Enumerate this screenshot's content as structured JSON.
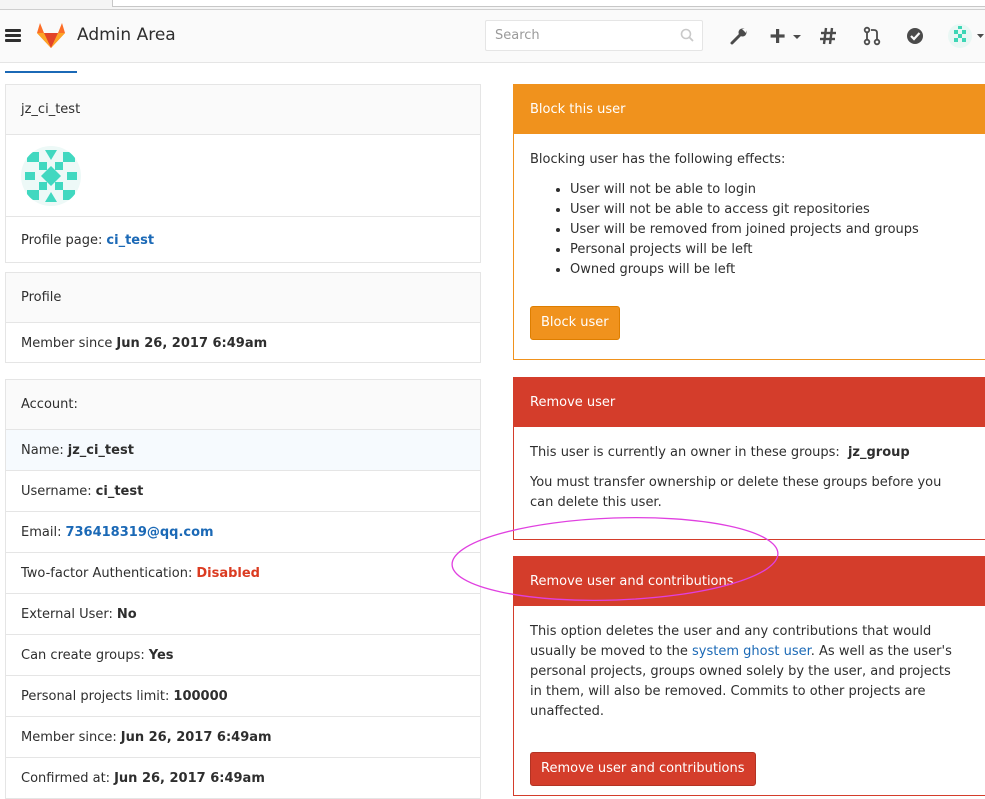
{
  "navbar": {
    "title": "Admin Area",
    "search_placeholder": "Search",
    "icons": [
      "menu-icon",
      "gitlab-logo",
      "search-icon",
      "wrench-icon",
      "plus-icon",
      "hash-icon",
      "merge-request-icon",
      "todo-check-icon",
      "avatar"
    ]
  },
  "profile_card": {
    "username_title": "jz_ci_test",
    "profile_page_label": "Profile page:",
    "profile_page_link": "ci_test"
  },
  "profile_panel": {
    "heading": "Profile",
    "member_since_label": "Member since",
    "member_since_value": "Jun 26, 2017 6:49am"
  },
  "account_panel": {
    "heading": "Account:",
    "rows": [
      {
        "label": "Name:",
        "value": "jz_ci_test"
      },
      {
        "label": "Username:",
        "value": "ci_test"
      },
      {
        "label": "Email:",
        "value": "736418319@qq.com"
      },
      {
        "label": "Two-factor Authentication:",
        "value": "Disabled"
      },
      {
        "label": "External User:",
        "value": "No"
      },
      {
        "label": "Can create groups:",
        "value": "Yes"
      },
      {
        "label": "Personal projects limit:",
        "value": "100000"
      },
      {
        "label": "Member since:",
        "value": "Jun 26, 2017 6:49am"
      },
      {
        "label": "Confirmed at:",
        "value": "Jun 26, 2017 6:49am"
      }
    ]
  },
  "block_panel": {
    "heading": "Block this user",
    "intro": "Blocking user has the following effects:",
    "effects": [
      "User will not be able to login",
      "User will not be able to access git repositories",
      "User will be removed from joined projects and groups",
      "Personal projects will be left",
      "Owned groups will be left"
    ],
    "button": "Block user"
  },
  "remove_panel": {
    "heading": "Remove user",
    "owner_text": "This user is currently an owner in these groups:",
    "owner_group": "jz_group",
    "transfer_text": "You must transfer ownership or delete these groups before you can delete this user."
  },
  "remove_contrib_panel": {
    "heading": "Remove user and contributions",
    "text_before": "This option deletes the user and any contributions that would usually be moved to the",
    "ghost_link": "system ghost user",
    "text_after": ". As well as the user's personal projects, groups owned solely by the user, and projects in them, will also be removed. Commits to other projects are unaffected.",
    "button": "Remove user and contributions"
  },
  "colors": {
    "warning": "#f0921d",
    "danger": "#d43d2b",
    "link": "#1b69b6",
    "annotation": "#e040e0"
  }
}
